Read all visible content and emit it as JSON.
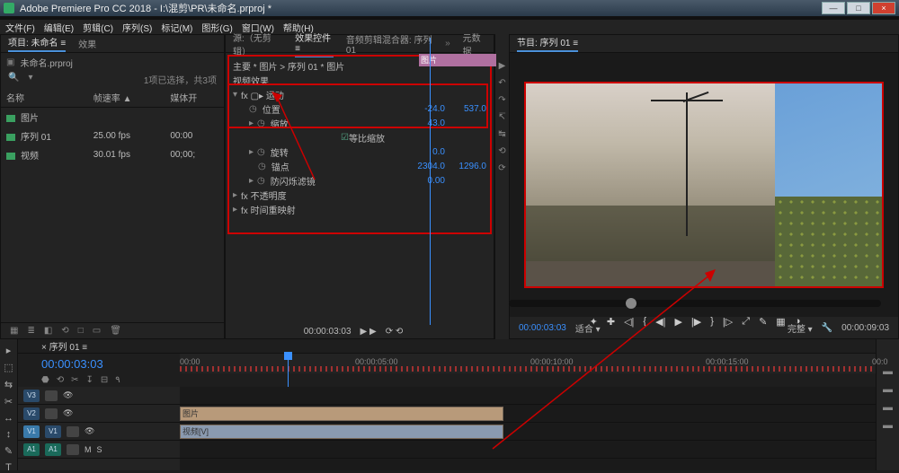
{
  "title": "Adobe Premiere Pro CC 2018 - I:\\混剪\\PR\\未命名.prproj *",
  "win_buttons": {
    "min": "—",
    "max": "□",
    "close": "×"
  },
  "menu": [
    "文件(F)",
    "编辑(E)",
    "剪辑(C)",
    "序列(S)",
    "标记(M)",
    "图形(G)",
    "窗口(W)",
    "帮助(H)"
  ],
  "project": {
    "tabs": {
      "primary": "项目: 未命名 ≡",
      "secondary": "效果"
    },
    "filename": "未命名.prproj",
    "meta": "1项已选择，共3项",
    "icons": {
      "search": "🔍",
      "funnel": "▾",
      "list": "≣"
    },
    "columns": {
      "name": "名称",
      "framerate": "帧速率 ▲",
      "start": "媒体开"
    },
    "rows": [
      {
        "color": "#3aa060",
        "label": "图片",
        "rate": "",
        "start": ""
      },
      {
        "color": "#3aa060",
        "label": "序列 01",
        "rate": "25.00 fps",
        "start": "00:00"
      },
      {
        "color": "#3aa060",
        "label": "视频",
        "rate": "30.01 fps",
        "start": "00;00;"
      }
    ],
    "footer_icons": [
      "▦",
      "≣",
      "◧",
      "⟲",
      "□",
      "▭",
      "🗑"
    ]
  },
  "source_tabs": {
    "t1": "源:（无剪辑）",
    "t2": "效果控件 ≡",
    "t3": "音频剪辑混合器: 序列 01",
    "t4": "元数据"
  },
  "effects": {
    "header": "主要 * 图片  >  序列 01 * 图片",
    "section": "视频效果",
    "motion": "fx ▢▸ 运动",
    "rows": {
      "position": {
        "label": "位置",
        "v1": "-24.0",
        "v2": "537.0"
      },
      "scale": {
        "label": "缩放",
        "v1": "43.0"
      },
      "uniform": "等比缩放",
      "rotation": {
        "label": "旋转",
        "v1": "0.0"
      },
      "anchor": {
        "label": "锚点",
        "v1": "2304.0",
        "v2": "1296.0"
      },
      "flicker": {
        "label": "防闪烁滤镜",
        "v1": "0.00"
      },
      "opacity": "fx 不透明度",
      "remap": "fx 时间重映射"
    },
    "timeline_thumb": "图片",
    "tc": "00:00:03:03"
  },
  "side_icons": [
    "▶",
    "↶",
    "↷",
    "↸",
    "↹",
    "⟲",
    "⟳"
  ],
  "program": {
    "tab": "节目: 序列 01 ≡",
    "tc_left": "00:00:03:03",
    "fit": "适合",
    "full": "完整",
    "tc_right": "00:00:09:03",
    "controls": [
      "✦",
      "✚",
      "◁|",
      "{",
      "◀|",
      "▶",
      "|▶",
      "}",
      "|▷",
      "⤢",
      "✎",
      "▦",
      "◑"
    ]
  },
  "timeline": {
    "tab": "× 序列 01 ≡",
    "tc": "00:00:03:03",
    "ticks": [
      "00:00",
      "00:00:05:00",
      "00:00:10:00",
      "00:00:15:00",
      "00:0"
    ],
    "tools": [
      "▸",
      "⬚",
      "⇆",
      "✂",
      "↔",
      "↕",
      "✎",
      "T"
    ],
    "tracks": {
      "v3": "V3",
      "v2": "V2",
      "v1": "V1",
      "a1": "A1",
      "lock": "🔒",
      "eye": "👁",
      "mute": "M",
      "solo": "S"
    },
    "clips": {
      "c1": "图片",
      "c2": "视频[V]"
    },
    "head_icons": [
      "⬣",
      "⟲",
      "✂",
      "↧",
      "⊟",
      "٩"
    ]
  }
}
